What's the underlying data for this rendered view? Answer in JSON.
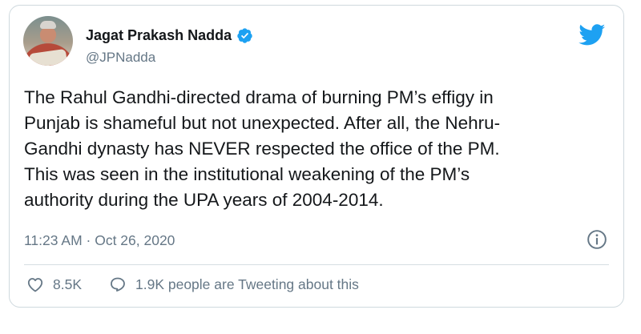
{
  "author": {
    "name": "Jagat Prakash Nadda",
    "handle": "@JPNadda"
  },
  "tweet": {
    "text": "The Rahul Gandhi-directed drama of burning PM’s effigy in\nPunjab is shameful but not unexpected. After all, the Nehru-\nGandhi dynasty has NEVER respected the office of the PM.\nThis was seen in the institutional weakening of the PM’s\nauthority during the UPA years of 2004-2014.",
    "time": "11:23 AM",
    "separator": " · ",
    "date": "Oct 26, 2020"
  },
  "actions": {
    "likes": "8.5K",
    "discussion": "1.9K people are Tweeting about this"
  },
  "icons": {
    "brand": "twitter-bird-icon",
    "verified": "verified-badge-icon",
    "info": "info-icon",
    "like": "heart-icon",
    "reply": "speech-bubble-icon"
  },
  "colors": {
    "twitter_blue": "#1da1f2",
    "text": "#14171a",
    "muted": "#657786",
    "border": "#cfd9de"
  }
}
